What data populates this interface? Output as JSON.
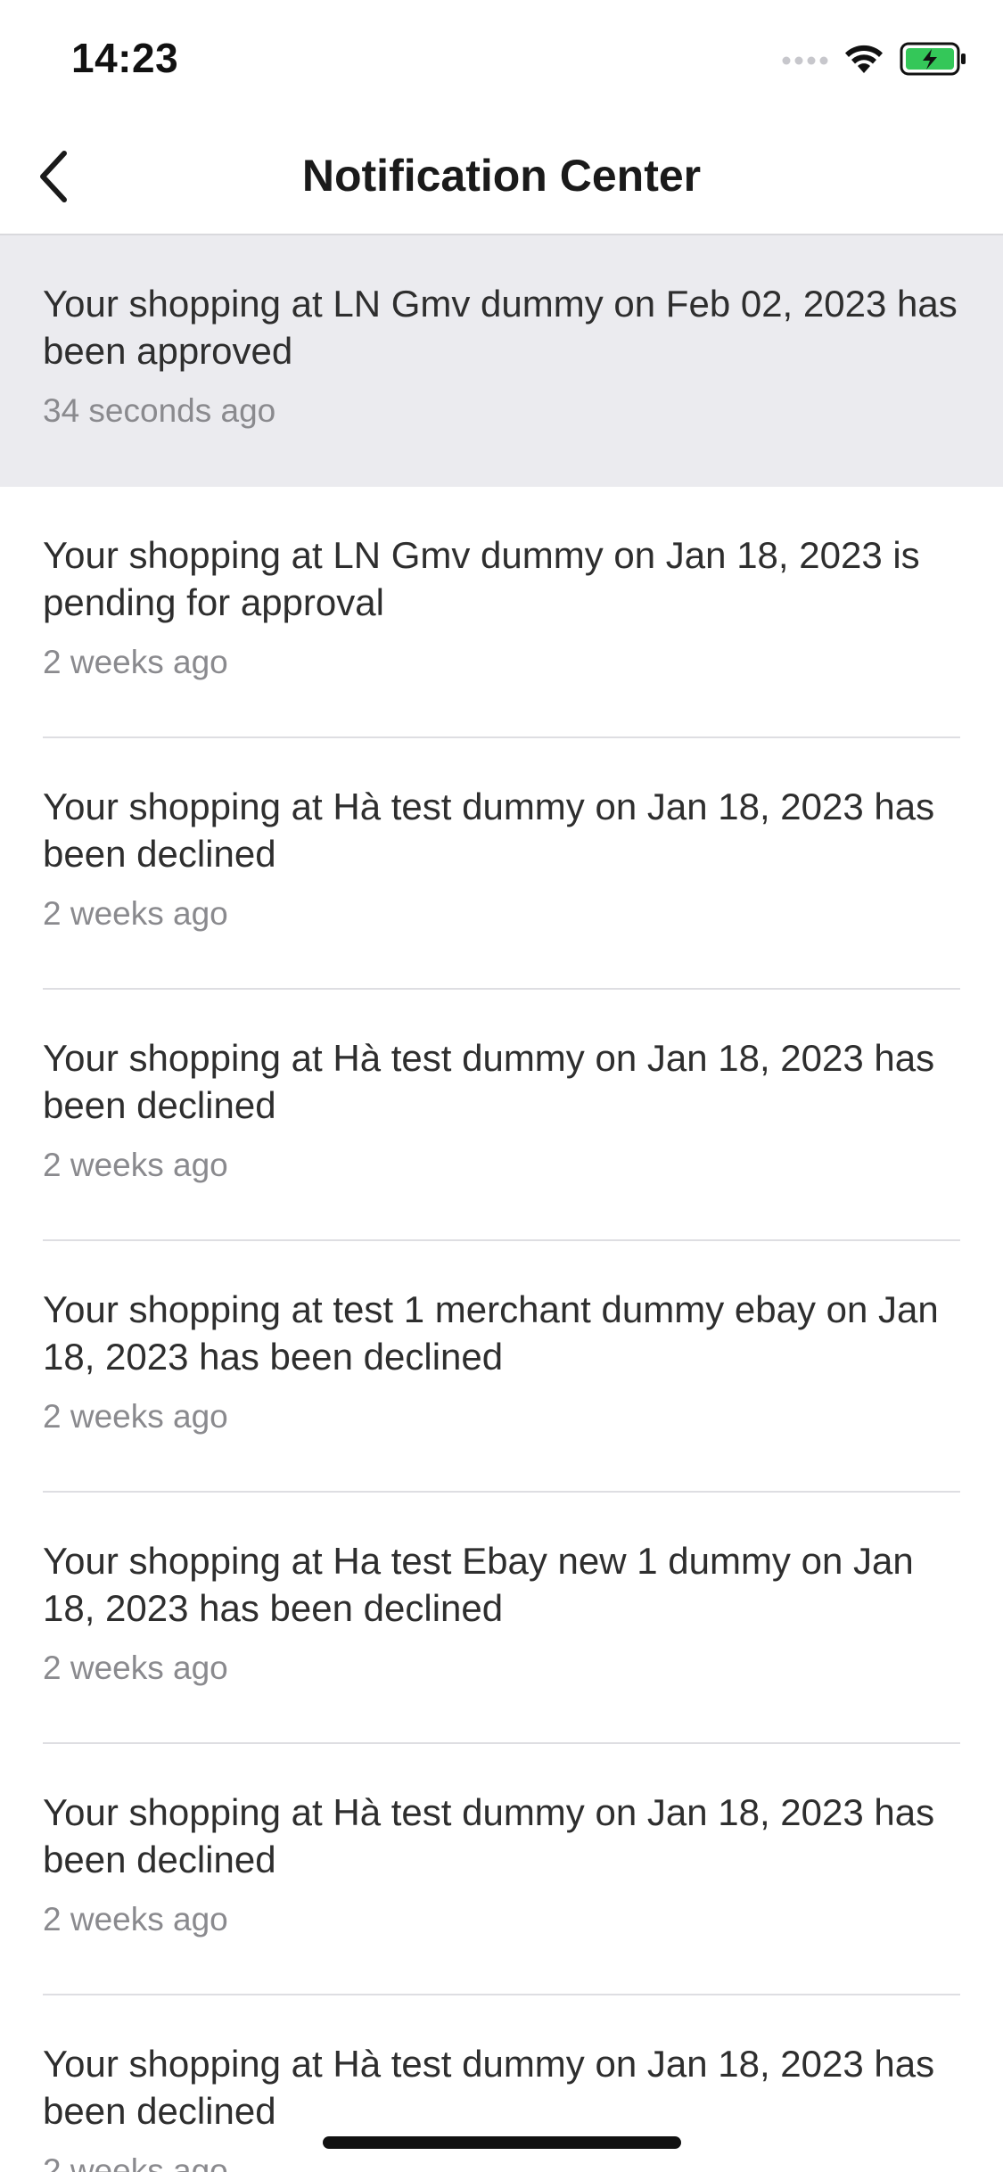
{
  "status_bar": {
    "time": "14:23",
    "icons": [
      "signal-icon",
      "wifi-icon",
      "battery-charging-icon"
    ],
    "battery_color": "#34c759"
  },
  "nav": {
    "title": "Notification Center",
    "back_icon": "chevron-left-icon"
  },
  "notifications": [
    {
      "message": "Your shopping at LN Gmv dummy on Feb 02, 2023 has been approved",
      "time": "34 seconds ago",
      "highlighted": true
    },
    {
      "message": "Your shopping at LN Gmv dummy on Jan 18, 2023 is pending for approval",
      "time": "2 weeks ago",
      "highlighted": false
    },
    {
      "message": "Your shopping at Hà test dummy on Jan 18, 2023 has been declined",
      "time": "2 weeks ago",
      "highlighted": false
    },
    {
      "message": "Your shopping at Hà test dummy on Jan 18, 2023 has been declined",
      "time": "2 weeks ago",
      "highlighted": false
    },
    {
      "message": "Your shopping at test 1 merchant dummy ebay on Jan 18, 2023 has been declined",
      "time": "2 weeks ago",
      "highlighted": false
    },
    {
      "message": "Your shopping at Ha test Ebay new 1 dummy on Jan 18, 2023 has been declined",
      "time": "2 weeks ago",
      "highlighted": false
    },
    {
      "message": "Your shopping at Hà test dummy on Jan 18, 2023 has been declined",
      "time": "2 weeks ago",
      "highlighted": false
    },
    {
      "message": "Your shopping at Hà test dummy on Jan 18, 2023 has been declined",
      "time": "2 weeks ago",
      "highlighted": false
    }
  ],
  "colors": {
    "highlight_bg": "#ebebef",
    "secondary_text": "#8a8a8e",
    "divider": "#dedee2"
  }
}
